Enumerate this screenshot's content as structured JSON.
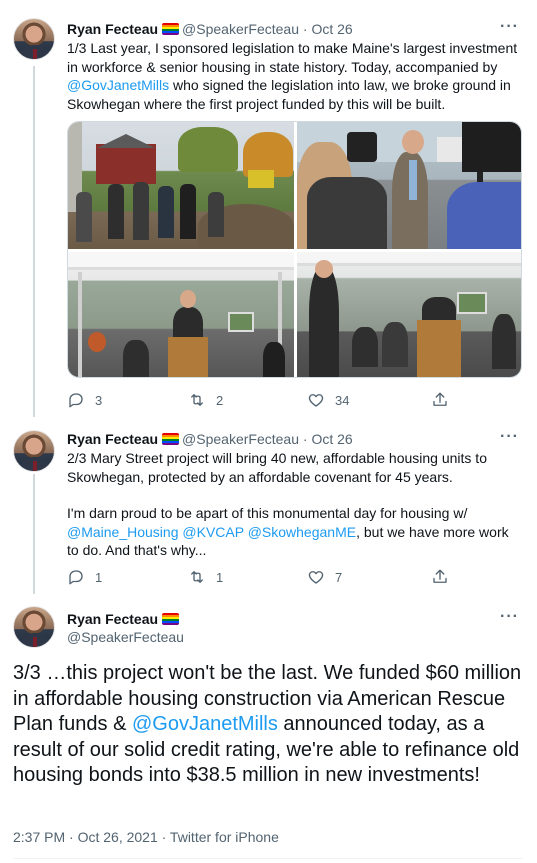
{
  "tweets": [
    {
      "name": "Ryan Fecteau",
      "handle": "@SpeakerFecteau",
      "sep": "·",
      "date": "Oct 26",
      "text_parts": [
        "1/3 Last year, I sponsored legislation to make Maine's largest investment in workforce & senior housing in state history. Today, accompanied by ",
        "@GovJanetMills",
        " who signed the legislation into law, we broke ground in Skowhegan where the first project funded by this will be built."
      ],
      "replies": "3",
      "retweets": "2",
      "likes": "34"
    },
    {
      "name": "Ryan Fecteau",
      "handle": "@SpeakerFecteau",
      "sep": "·",
      "date": "Oct 26",
      "text_p1": "2/3 Mary Street project will bring 40 new, affordable housing units to Skowhegan, protected by an affordable covenant for 45 years.",
      "text_p2_parts": [
        "I'm darn proud to be apart of this monumental day for housing w/ ",
        "@Maine_Housing",
        " ",
        "@KVCAP",
        " ",
        "@SkowheganME",
        ", but we have more work to do. And that's why..."
      ],
      "replies": "1",
      "retweets": "1",
      "likes": "7"
    }
  ],
  "main_tweet": {
    "name": "Ryan Fecteau",
    "handle": "@SpeakerFecteau",
    "text_parts": [
      "3/3 …this project won't be the last. We funded $60 million in affordable housing construction via American Rescue Plan funds & ",
      "@GovJanetMills",
      " announced today, as a result of our solid credit rating, we're able to refinance old housing bonds into $38.5 million in new investments!"
    ],
    "timestamp": "2:37 PM · Oct 26, 2021 · Twitter for iPhone"
  },
  "more_label": "···",
  "colors": {
    "link": "#1d9bf0",
    "secondary": "#536471",
    "text": "#0f1419",
    "line": "#cfd9de"
  },
  "icons": [
    "reply-icon",
    "retweet-icon",
    "like-icon",
    "share-icon",
    "more-icon",
    "rainbow-flag-icon"
  ]
}
